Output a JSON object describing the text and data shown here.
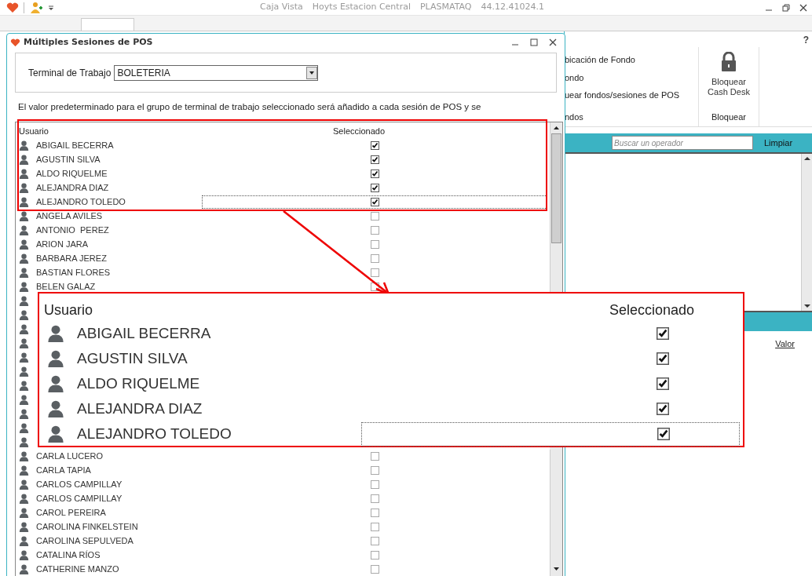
{
  "app": {
    "title_parts": [
      "Caja Vista",
      "Hoyts Estacion Central",
      "PLASMATAQ",
      "44.12.41024.1"
    ],
    "help": "?"
  },
  "ribbon": {
    "items": [
      "bicación de Fondo",
      "ondo",
      "uear fondos/sesiones de POS"
    ],
    "group_label": "ndos",
    "lock_button": "Bloquear Cash Desk",
    "lock_group": "Bloquear"
  },
  "operators": {
    "search_placeholder": "Buscar un operador",
    "clear": "Limpiar"
  },
  "details": {
    "column": "Valor"
  },
  "dialog": {
    "title": "Múltiples Sesiones de POS",
    "terminal_label": "Terminal de Trabajo",
    "terminal_value": "BOLETERIA",
    "description": "El valor predeterminado para el grupo de terminal de trabajo seleccionado será añadido a cada sesión de POS y se",
    "columns": [
      "Usuario",
      "Seleccionado"
    ],
    "users_top": [
      {
        "name": "ABIGAIL BECERRA",
        "checked": true,
        "focused": false
      },
      {
        "name": "AGUSTIN SILVA",
        "checked": true,
        "focused": false
      },
      {
        "name": "ALDO RIQUELME",
        "checked": true,
        "focused": false
      },
      {
        "name": "ALEJANDRA DIAZ",
        "checked": true,
        "focused": false
      },
      {
        "name": "ALEJANDRO TOLEDO",
        "checked": true,
        "focused": true
      },
      {
        "name": "ANGELA AVILES",
        "checked": false,
        "focused": false
      },
      {
        "name": "ANTONIO  PEREZ",
        "checked": false,
        "focused": false
      },
      {
        "name": "ARION JARA",
        "checked": false,
        "focused": false
      },
      {
        "name": "BARBARA JEREZ",
        "checked": false,
        "focused": false
      },
      {
        "name": "BASTIAN FLORES",
        "checked": false,
        "focused": false
      },
      {
        "name": "BELEN GALAZ",
        "checked": false,
        "focused": false
      }
    ],
    "users_bottom": [
      {
        "name": "CARLA LUCERO",
        "checked": false,
        "focused": false
      },
      {
        "name": "CARLA TAPIA",
        "checked": false,
        "focused": false
      },
      {
        "name": "CARLOS CAMPILLAY",
        "checked": false,
        "focused": false
      },
      {
        "name": "CARLOS CAMPILLAY",
        "checked": false,
        "focused": false
      },
      {
        "name": "CAROL PEREIRA",
        "checked": false,
        "focused": false
      },
      {
        "name": "CAROLINA FINKELSTEIN",
        "checked": false,
        "focused": false
      },
      {
        "name": "CAROLINA SEPULVEDA",
        "checked": false,
        "focused": false
      },
      {
        "name": "CATALINA RÍOS",
        "checked": false,
        "focused": false
      },
      {
        "name": "CATHERINE MANZO",
        "checked": false,
        "focused": false
      }
    ]
  },
  "callout": {
    "columns": [
      "Usuario",
      "Seleccionado"
    ],
    "users": [
      {
        "name": "ABIGAIL BECERRA",
        "checked": true,
        "focused": false
      },
      {
        "name": "AGUSTIN SILVA",
        "checked": true,
        "focused": false
      },
      {
        "name": "ALDO RIQUELME",
        "checked": true,
        "focused": false
      },
      {
        "name": "ALEJANDRA DIAZ",
        "checked": true,
        "focused": false
      },
      {
        "name": "ALEJANDRO TOLEDO",
        "checked": true,
        "focused": true
      }
    ]
  }
}
